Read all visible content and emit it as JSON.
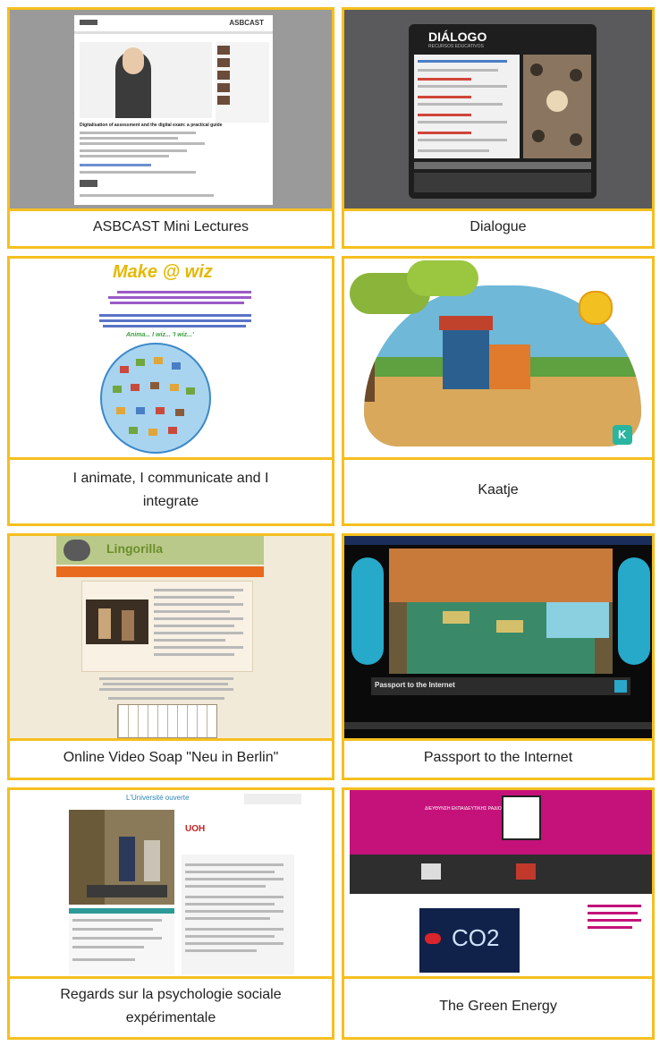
{
  "cards": [
    {
      "caption": "ASBCAST Mini Lectures",
      "thumb": {
        "logo": "ASBCAST",
        "title": "Digitalisation of assessment and the digital exam: a practical guide"
      }
    },
    {
      "caption": "Dialogue",
      "thumb": {
        "logo": "DIÁLOGO",
        "subtitle": "RECURSOS EDUCATIVOS"
      }
    },
    {
      "caption": "I animate, I communicate and I integrate",
      "thumb": {
        "logo": "Make @ wiz",
        "tagline": "Anima... I wiz... 'I wiz...'"
      }
    },
    {
      "caption": "Kaatje",
      "thumb": {
        "badge": "K"
      }
    },
    {
      "caption": "Online Video Soap \"Neu in Berlin\"",
      "thumb": {
        "logo": "Lingorilla"
      }
    },
    {
      "caption": "Passport to the Internet",
      "thumb": {
        "banner": "Passport to the Internet"
      }
    },
    {
      "caption": "Regards sur la psychologie sociale expérimentale",
      "thumb": {
        "header": "L'Université ouverte",
        "logo": "UOH"
      }
    },
    {
      "caption": "The Green Energy",
      "thumb": {
        "title": "ΔΙΕΥΘΥΝΣΗ ΕΚΠΑΙΔΕΥΤΙΚΗΣ ΡΑΔΙΟΤΗΛΕΟΡΑΣΗΣ",
        "video_text": "CO2"
      }
    }
  ],
  "colors": {
    "border": "#f5bf1f",
    "caption_text": "#222222"
  }
}
